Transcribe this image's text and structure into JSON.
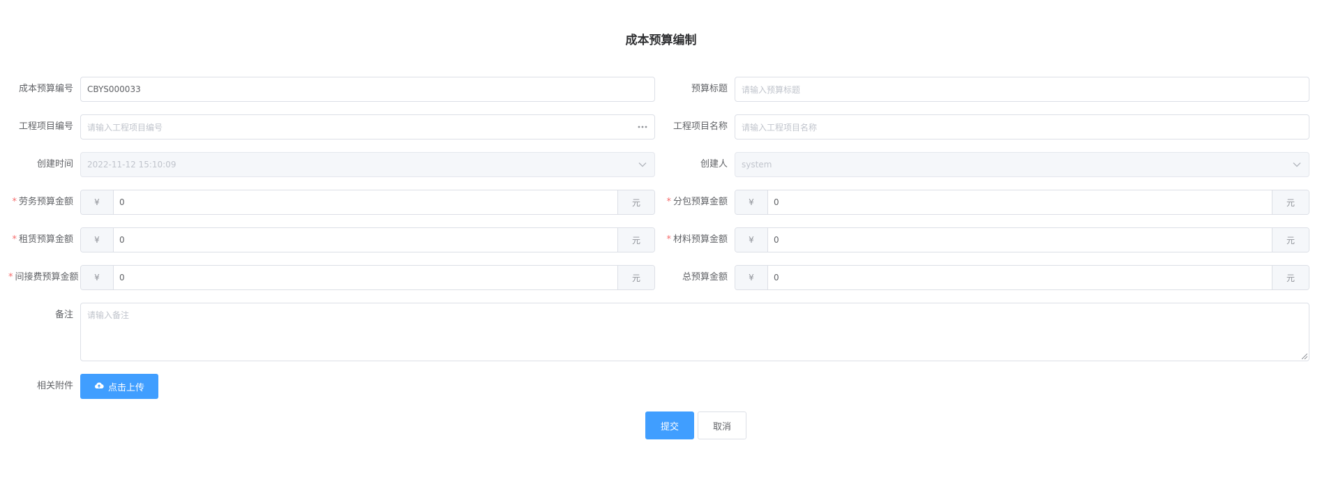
{
  "page": {
    "title": "成本预算编制"
  },
  "form": {
    "budget_no": {
      "label": "成本预算编号",
      "value": "CBYS000033"
    },
    "budget_title": {
      "label": "预算标题",
      "placeholder": "请输入预算标题"
    },
    "project_no": {
      "label": "工程项目编号",
      "placeholder": "请输入工程项目编号"
    },
    "project_name": {
      "label": "工程项目名称",
      "placeholder": "请输入工程项目名称"
    },
    "created_at": {
      "label": "创建时间",
      "value": "2022-11-12 15:10:09"
    },
    "creator": {
      "label": "创建人",
      "value": "system"
    },
    "labor": {
      "label": "劳务预算金额",
      "required": "*",
      "prefix": "¥",
      "value": "0",
      "suffix": "元"
    },
    "subcontract": {
      "label": "分包预算金额",
      "required": "*",
      "prefix": "¥",
      "value": "0",
      "suffix": "元"
    },
    "lease": {
      "label": "租赁预算金额",
      "required": "*",
      "prefix": "¥",
      "value": "0",
      "suffix": "元"
    },
    "material": {
      "label": "材料预算金额",
      "required": "*",
      "prefix": "¥",
      "value": "0",
      "suffix": "元"
    },
    "indirect": {
      "label": "间接费预算金额",
      "required": "*",
      "prefix": "¥",
      "value": "0",
      "suffix": "元"
    },
    "total": {
      "label": "总预算金额",
      "prefix": "¥",
      "value": "0",
      "suffix": "元"
    },
    "remark": {
      "label": "备注",
      "placeholder": "请输入备注"
    },
    "attachment": {
      "label": "相关附件",
      "button": "点击上传"
    }
  },
  "actions": {
    "submit": "提交",
    "cancel": "取消"
  },
  "colors": {
    "primary": "#409eff",
    "required": "#f56c6c",
    "border": "#dcdfe6",
    "disabled_bg": "#f5f7fa"
  },
  "icons": {
    "more": "ellipsis-icon",
    "dropdown": "chevron-down-icon",
    "upload": "cloud-upload-icon"
  }
}
